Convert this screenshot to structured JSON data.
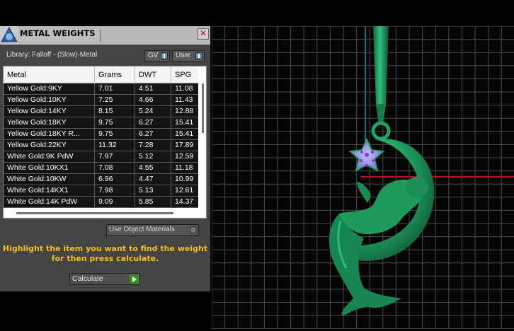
{
  "panel": {
    "title": "METAL WEIGHTS",
    "close_glyph": "✕",
    "library_label": "Library: Falloff - (Slow)-Metal",
    "unit_buttons": [
      {
        "label": "GV"
      },
      {
        "label": "User"
      }
    ],
    "table": {
      "columns": [
        "Metal",
        "Grams",
        "DWT",
        "SPG"
      ],
      "rows": [
        [
          "Yellow Gold:9KY",
          "7.01",
          "4.51",
          "11.08"
        ],
        [
          "Yellow Gold:10KY",
          "7.25",
          "4.66",
          "11.43"
        ],
        [
          "Yellow Gold:14KY",
          "8.15",
          "5.24",
          "12.88"
        ],
        [
          "Yellow Gold:18KY",
          "9.75",
          "6.27",
          "15.41"
        ],
        [
          "Yellow Gold:18KY R...",
          "9.75",
          "6.27",
          "15.41"
        ],
        [
          "Yellow Gold:22KY",
          "11.32",
          "7.28",
          "17.89"
        ],
        [
          "White Gold:9K PdW",
          "7.97",
          "5.12",
          "12.59"
        ],
        [
          "White Gold:10KX1",
          "7.08",
          "4.55",
          "11.18"
        ],
        [
          "White Gold:10KW",
          "6.96",
          "4.47",
          "10.99"
        ],
        [
          "White Gold:14KX1",
          "7.98",
          "5.13",
          "12.61"
        ],
        [
          "White Gold:14K PdW",
          "9.09",
          "5.85",
          "14.37"
        ]
      ]
    },
    "use_object_materials_label": "Use Object Materials",
    "hint_line1": "Highlight the item you want to find the weight",
    "hint_line2": "for then press calculate.",
    "calculate_label": "Calculate"
  },
  "viewport": {
    "model": "mermaid-on-crescent-moon-pendant",
    "model_color": "#1f9a60",
    "gem_color": "#a090e0",
    "grid_color": "#4a4a4a",
    "axis_color": "#b01818"
  }
}
